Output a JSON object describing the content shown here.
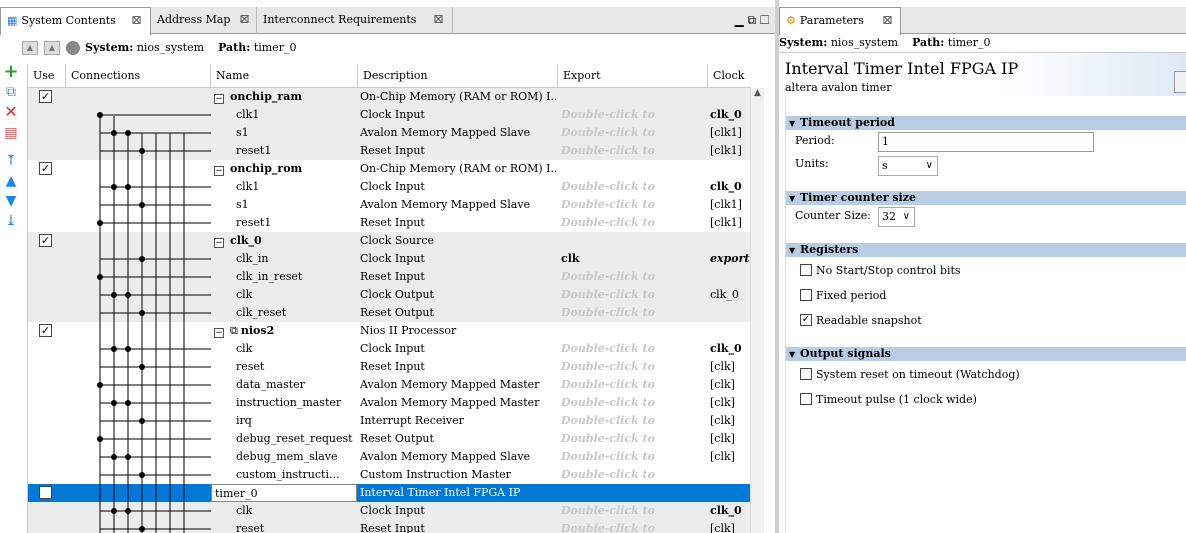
{
  "tabs": [
    {
      "label": "System Contents"
    },
    {
      "label": "Address Map"
    },
    {
      "label": "Interconnect Requirements"
    }
  ],
  "left_path": {
    "system_label": "System:",
    "system_value": "nios_system",
    "path_label": "Path:",
    "path_value": "timer_0"
  },
  "columns": {
    "use": "Use",
    "connections": "Connections",
    "name": "Name",
    "description": "Description",
    "export": "Export",
    "clock": "Clock"
  },
  "rows": [
    {
      "kind": "comp",
      "checked": true,
      "name": "onchip_ram",
      "desc": "On-Chip Memory (RAM or ROM) I...",
      "export": "",
      "clock": "",
      "shade": true
    },
    {
      "kind": "port",
      "name": "clk1",
      "desc": "Clock Input",
      "export": "Double-click to",
      "clock": "clk_0",
      "clockbold": true,
      "shade": true
    },
    {
      "kind": "port",
      "name": "s1",
      "desc": "Avalon Memory Mapped Slave",
      "export": "Double-click to",
      "clock": "[clk1]",
      "shade": true
    },
    {
      "kind": "port",
      "name": "reset1",
      "desc": "Reset Input",
      "export": "Double-click to",
      "clock": "[clk1]",
      "shade": true
    },
    {
      "kind": "comp",
      "checked": true,
      "name": "onchip_rom",
      "desc": "On-Chip Memory (RAM or ROM) I...",
      "export": "",
      "clock": "",
      "shade": false
    },
    {
      "kind": "port",
      "name": "clk1",
      "desc": "Clock Input",
      "export": "Double-click to",
      "clock": "clk_0",
      "clockbold": true,
      "shade": false
    },
    {
      "kind": "port",
      "name": "s1",
      "desc": "Avalon Memory Mapped Slave",
      "export": "Double-click to",
      "clock": "[clk1]",
      "shade": false
    },
    {
      "kind": "port",
      "name": "reset1",
      "desc": "Reset Input",
      "export": "Double-click to",
      "clock": "[clk1]",
      "shade": false
    },
    {
      "kind": "comp",
      "checked": true,
      "name": "clk_0",
      "desc": "Clock Source",
      "export": "",
      "clock": "",
      "shade": true
    },
    {
      "kind": "port",
      "name": "clk_in",
      "desc": "Clock Input",
      "export": "clk",
      "exportbold": true,
      "clock": "export",
      "clockital": true,
      "shade": true
    },
    {
      "kind": "port",
      "name": "clk_in_reset",
      "desc": "Reset Input",
      "export": "Double-click to",
      "clock": "",
      "shade": true
    },
    {
      "kind": "port",
      "name": "clk",
      "desc": "Clock Output",
      "export": "Double-click to",
      "clock": "clk_0",
      "shade": true
    },
    {
      "kind": "port",
      "name": "clk_reset",
      "desc": "Reset Output",
      "export": "Double-click to",
      "clock": "",
      "shade": true
    },
    {
      "kind": "comp",
      "checked": true,
      "name": "nios2",
      "desc": "Nios II Processor",
      "export": "",
      "clock": "",
      "shade": false,
      "icon": true
    },
    {
      "kind": "port",
      "name": "clk",
      "desc": "Clock Input",
      "export": "Double-click to",
      "clock": "clk_0",
      "clockbold": true,
      "shade": false
    },
    {
      "kind": "port",
      "name": "reset",
      "desc": "Reset Input",
      "export": "Double-click to",
      "clock": "[clk]",
      "shade": false
    },
    {
      "kind": "port",
      "name": "data_master",
      "desc": "Avalon Memory Mapped Master",
      "export": "Double-click to",
      "clock": "[clk]",
      "shade": false
    },
    {
      "kind": "port",
      "name": "instruction_master",
      "desc": "Avalon Memory Mapped Master",
      "export": "Double-click to",
      "clock": "[clk]",
      "shade": false
    },
    {
      "kind": "port",
      "name": "irq",
      "desc": "Interrupt Receiver",
      "export": "Double-click to",
      "clock": "[clk]",
      "shade": false
    },
    {
      "kind": "port",
      "name": "debug_reset_request",
      "desc": "Reset Output",
      "export": "Double-click to",
      "clock": "[clk]",
      "shade": false
    },
    {
      "kind": "port",
      "name": "debug_mem_slave",
      "desc": "Avalon Memory Mapped Slave",
      "export": "Double-click to",
      "clock": "[clk]",
      "shade": false
    },
    {
      "kind": "port",
      "name": "custom_instructi...",
      "desc": "Custom Instruction Master",
      "export": "Double-click to",
      "clock": "",
      "shade": false
    },
    {
      "kind": "comp",
      "checked": true,
      "name": "timer_0",
      "desc": "Interval Timer Intel FPGA IP",
      "export": "",
      "clock": "",
      "selected": true
    },
    {
      "kind": "port",
      "name": "clk",
      "desc": "Clock Input",
      "export": "Double-click to",
      "clock": "clk_0",
      "clockbold": true,
      "shade": true
    },
    {
      "kind": "port",
      "name": "reset",
      "desc": "Reset Input",
      "export": "Double-click to",
      "clock": "[clk]",
      "shade": true
    }
  ],
  "params": {
    "tab_label": "Parameters",
    "system_label": "System:",
    "system_value": "nios_system",
    "path_label": "Path:",
    "path_value": "timer_0",
    "title": "Interval Timer Intel FPGA IP",
    "subtitle": "altera avalon timer",
    "sec_timeout": "Timeout period",
    "period_label": "Period:",
    "period_value": "1",
    "units_label": "Units:",
    "units_value": "s",
    "sec_counter": "Timer counter size",
    "counter_label": "Counter Size:",
    "counter_value": "32",
    "sec_registers": "Registers",
    "reg_no_startstop": "No Start/Stop control bits",
    "reg_no_startstop_checked": false,
    "reg_fixed": "Fixed period",
    "reg_fixed_checked": false,
    "reg_readable": "Readable snapshot",
    "reg_readable_checked": true,
    "sec_output": "Output signals",
    "out_sysreset": "System reset on timeout (Watchdog)",
    "out_sysreset_checked": false,
    "out_pulse": "Timeout pulse (1 clock wide)",
    "out_pulse_checked": false
  },
  "colors": {
    "selected": "#0078d7",
    "section": "#b8cde4",
    "shade": "#ececec"
  }
}
